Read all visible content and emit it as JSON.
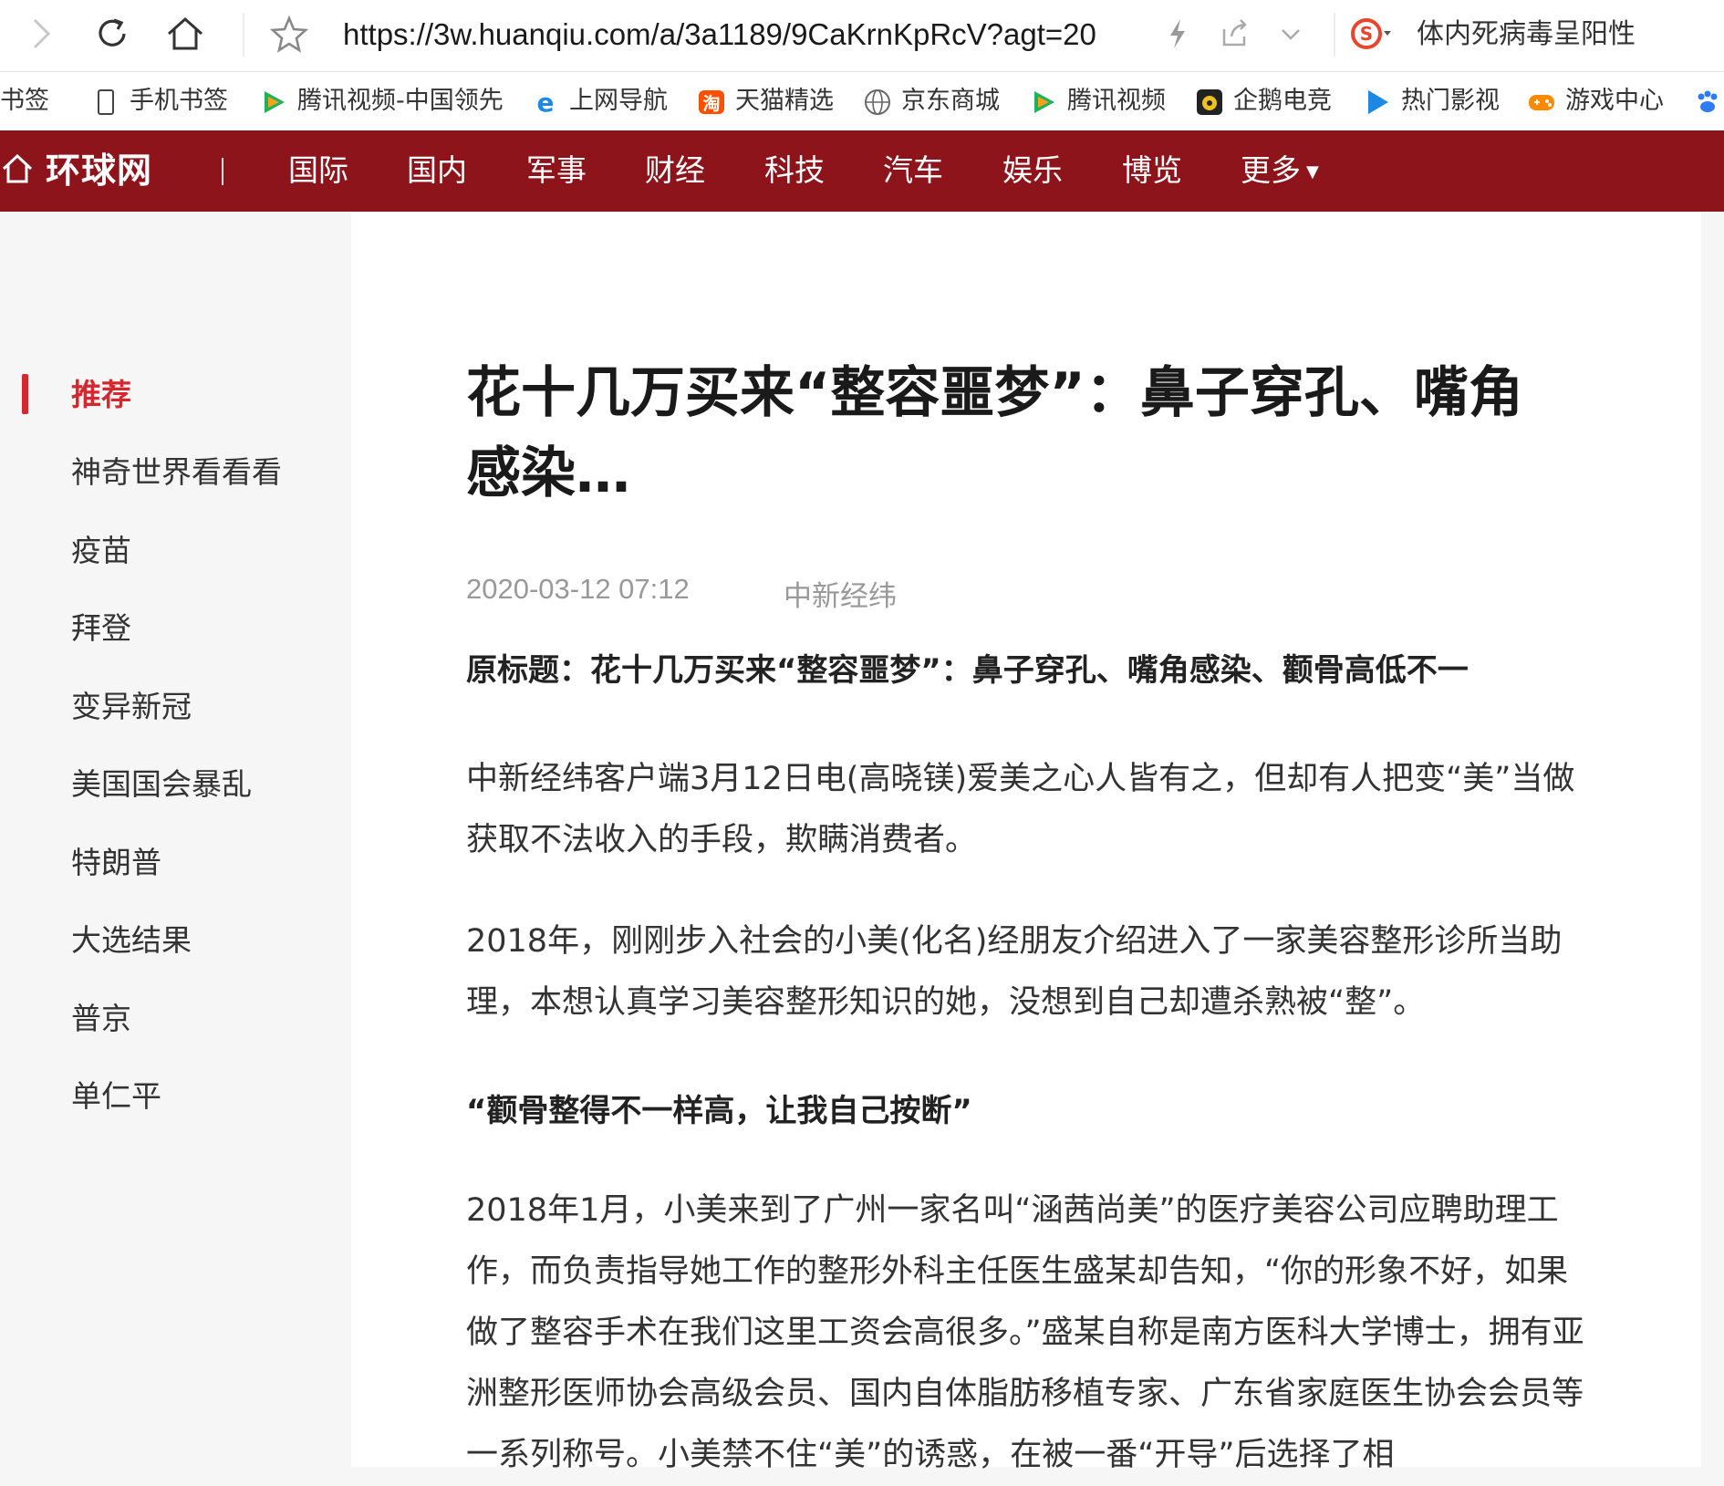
{
  "browser": {
    "url": "https://3w.huanqiu.com/a/3a1189/9CaKrnKpRcV?agt=20",
    "search_text": "体内死病毒呈阳性"
  },
  "bookmarks": [
    {
      "label": "书签"
    },
    {
      "label": "手机书签"
    },
    {
      "label": "腾讯视频-中国领先"
    },
    {
      "label": "上网导航"
    },
    {
      "label": "天猫精选"
    },
    {
      "label": "京东商城"
    },
    {
      "label": "腾讯视频"
    },
    {
      "label": "企鹅电竞"
    },
    {
      "label": "热门影视"
    },
    {
      "label": "游戏中心"
    }
  ],
  "site": {
    "logo": "环球网",
    "nav": [
      "国际",
      "国内",
      "军事",
      "财经",
      "科技",
      "汽车",
      "娱乐",
      "博览",
      "更多"
    ]
  },
  "sidebar": {
    "items": [
      "推荐",
      "神奇世界看看看",
      "疫苗",
      "拜登",
      "变异新冠",
      "美国国会暴乱",
      "特朗普",
      "大选结果",
      "普京",
      "单仁平"
    ]
  },
  "article": {
    "title": "花十几万买来“整容噩梦”：鼻子穿孔、嘴角感染…",
    "date": "2020-03-12 07:12",
    "source": "中新经纬",
    "original_title": "原标题：花十几万买来“整容噩梦”：鼻子穿孔、嘴角感染、颧骨高低不一",
    "p1": "中新经纬客户端3月12日电(高晓镁)爱美之心人皆有之，但却有人把变“美”当做获取不法收入的手段，欺瞒消费者。",
    "p2": "2018年，刚刚步入社会的小美(化名)经朋友介绍进入了一家美容整形诊所当助理，本想认真学习美容整形知识的她，没想到自己却遭杀熟被“整”。",
    "subheading": "“颧骨整得不一样高，让我自己按断”",
    "p3": "2018年1月，小美来到了广州一家名叫“涵茜尚美”的医疗美容公司应聘助理工作，而负责指导她工作的整形外科主任医生盛某却告知，“你的形象不好，如果做了整容手术在我们这里工资会高很多。”盛某自称是南方医科大学博士，拥有亚洲整形医师协会高级会员、国内自体脂肪移植专家、广东省家庭医生协会会员等一系列称号。小美禁不住“美”的诱惑，在被一番“开导”后选择了相"
  },
  "colors": {
    "nav_bg": "#8e141b",
    "accent_red": "#d4282f"
  }
}
